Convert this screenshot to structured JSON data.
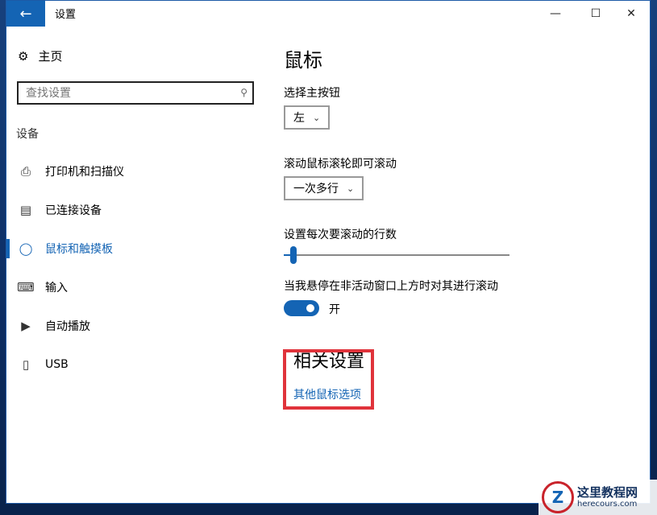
{
  "window": {
    "title": "设置"
  },
  "titlebar": {
    "back_icon": "back-arrow-icon",
    "minimize": "—",
    "maximize": "☐",
    "close": "✕"
  },
  "sidebar": {
    "home_label": "主页",
    "search_placeholder": "查找设置",
    "section": "设备",
    "items": [
      {
        "label": "打印机和扫描仪",
        "icon": "printer-icon",
        "active": false
      },
      {
        "label": "已连接设备",
        "icon": "connected-devices-icon",
        "active": false
      },
      {
        "label": "鼠标和触摸板",
        "icon": "mouse-icon",
        "active": true
      },
      {
        "label": "输入",
        "icon": "keyboard-icon",
        "active": false
      },
      {
        "label": "自动播放",
        "icon": "autoplay-icon",
        "active": false
      },
      {
        "label": "USB",
        "icon": "usb-icon",
        "active": false
      }
    ]
  },
  "main": {
    "title": "鼠标",
    "primary_button": {
      "label": "选择主按钮",
      "value": "左"
    },
    "scroll_mode": {
      "label": "滚动鼠标滚轮即可滚动",
      "value": "一次多行"
    },
    "scroll_lines": {
      "label": "设置每次要滚动的行数",
      "value_fraction": 0.03
    },
    "inactive_scroll": {
      "label": "当我悬停在非活动窗口上方时对其进行滚动",
      "state": "开"
    },
    "related": {
      "title": "相关设置",
      "link": "其他鼠标选项"
    }
  },
  "watermark": {
    "main": "这里教程网",
    "sub": "herecours.com",
    "logo": "Z"
  },
  "colors": {
    "accent": "#1464b4",
    "highlight": "#e0333b"
  }
}
